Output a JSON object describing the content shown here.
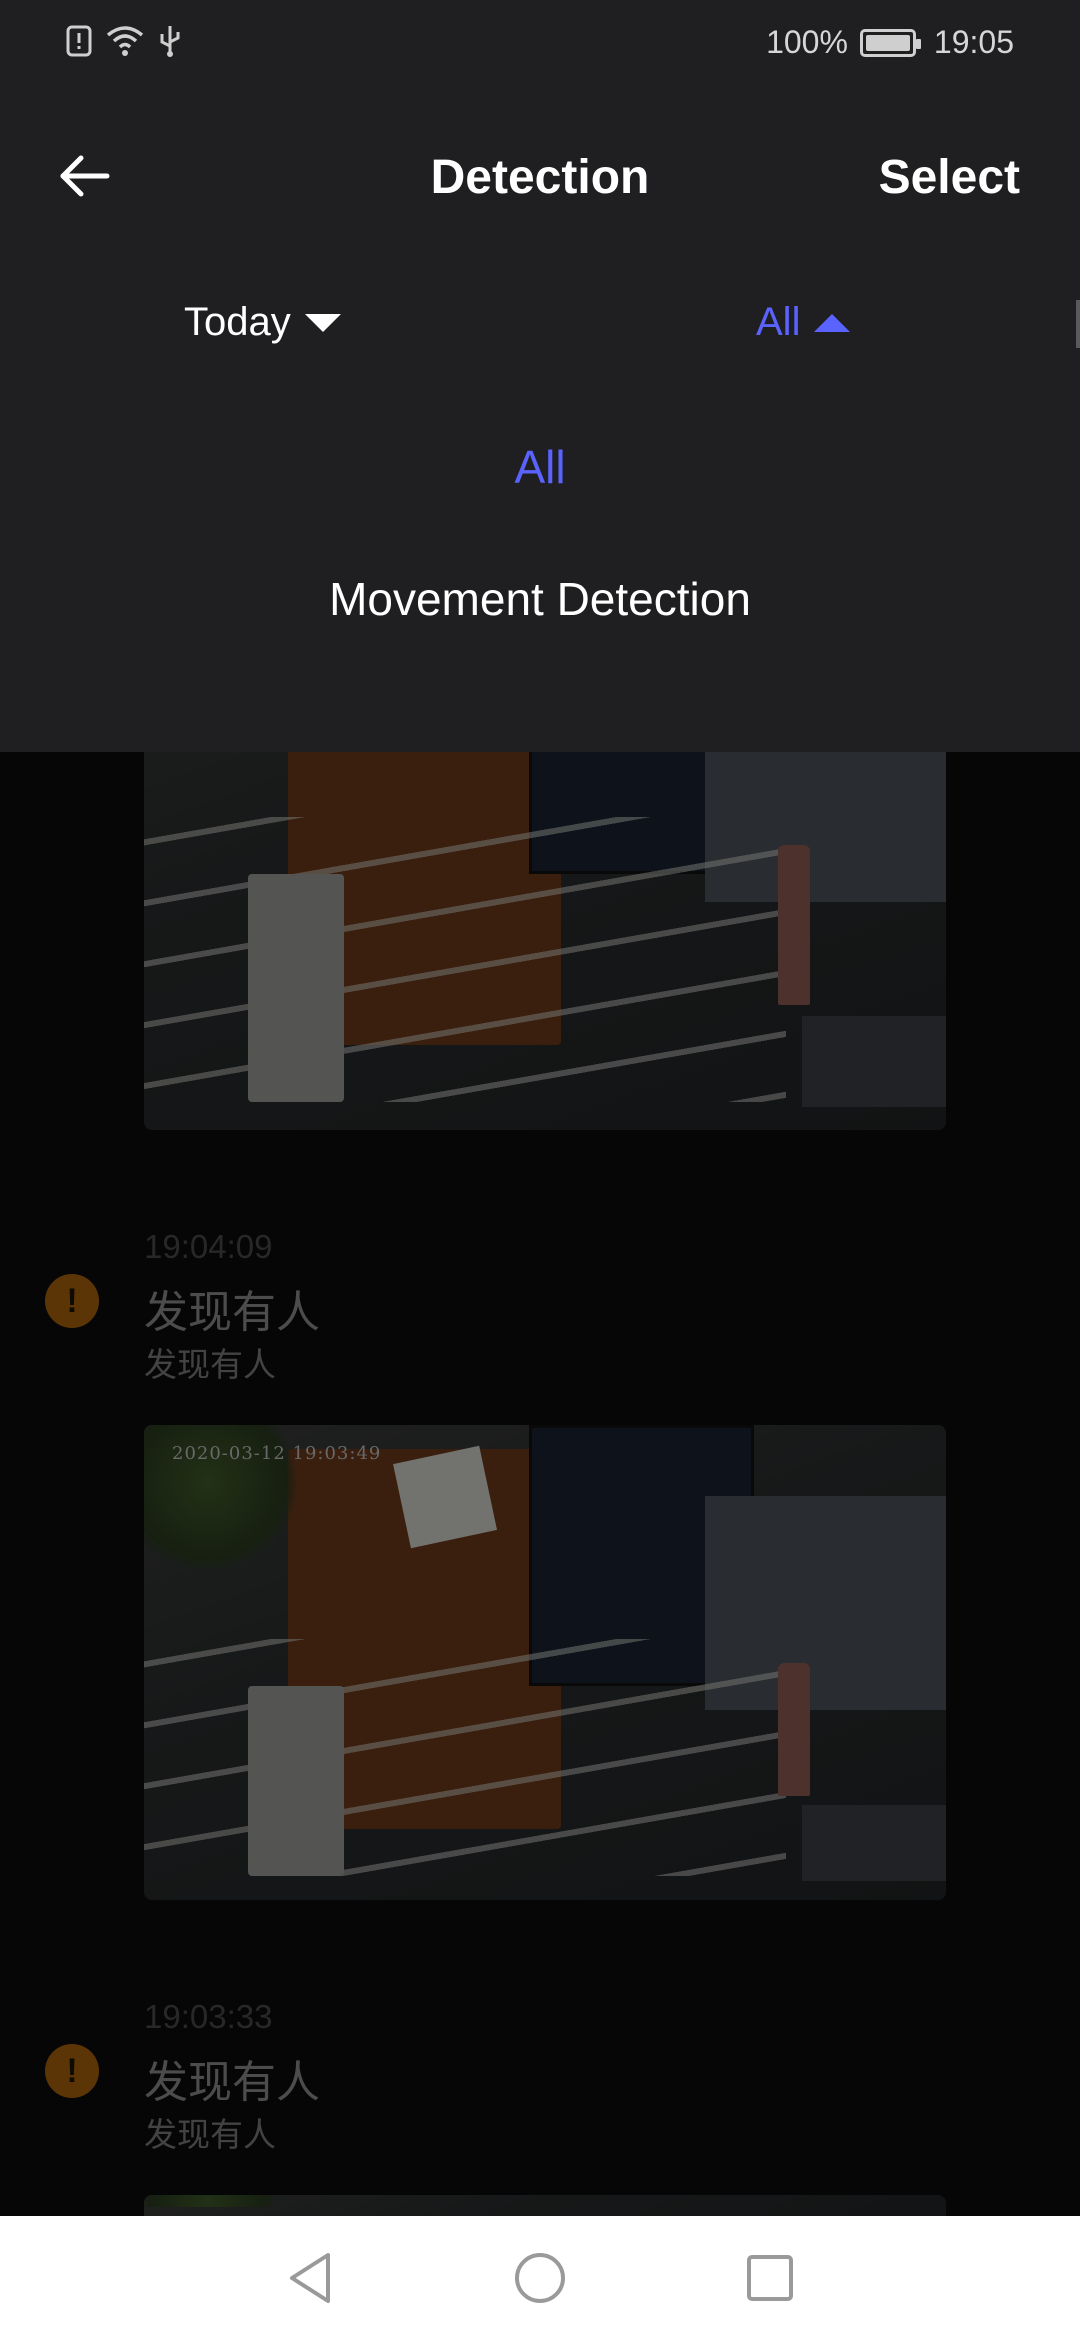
{
  "status_bar": {
    "battery_percent": "100%",
    "time": "19:05",
    "icons": [
      "sim-alert-icon",
      "wifi-icon",
      "usb-icon",
      "battery-charging-icon"
    ]
  },
  "header": {
    "title": "Detection",
    "select_label": "Select",
    "back_icon": "back-arrow-icon"
  },
  "filters": {
    "date_label": "Today",
    "type_label": "All",
    "type_active_color": "#5b63ff"
  },
  "dropdown": {
    "options": [
      {
        "label": "All",
        "selected": true
      },
      {
        "label": "Movement Detection",
        "selected": false
      }
    ]
  },
  "events": [
    {
      "time": "19:04:09",
      "title": "发现有人",
      "subtitle": "发现有人",
      "thumbnail_osd": "2020-03-12  19:03:49"
    },
    {
      "time": "19:03:33",
      "title": "发现有人",
      "subtitle": "发现有人"
    }
  ],
  "colors": {
    "panel_bg": "#1f1f21",
    "list_bg": "#0b0b0c",
    "accent": "#5b63ff",
    "alert": "#a8620b"
  }
}
